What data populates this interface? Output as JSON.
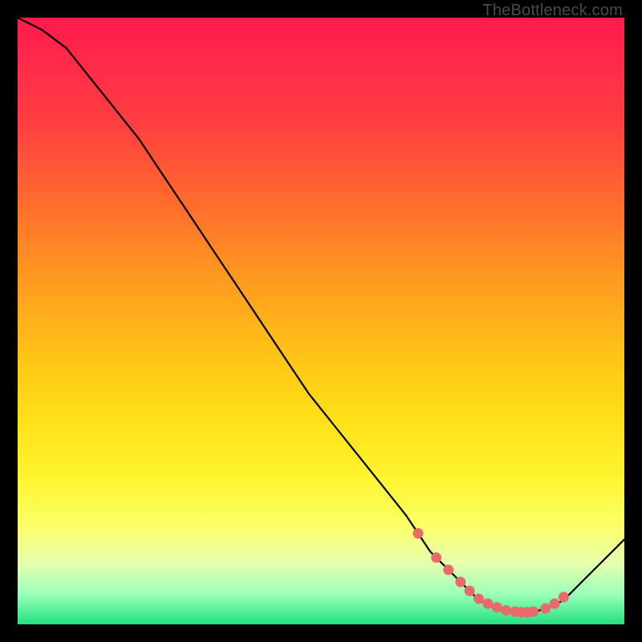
{
  "attribution": "TheBottleneck.com",
  "colors": {
    "page_bg": "#000000",
    "curve_stroke": "#000000",
    "marker_fill": "#e86a6a",
    "marker_stroke": "#e86a6a"
  },
  "chart_data": {
    "type": "line",
    "title": "",
    "xlabel": "",
    "ylabel": "",
    "xlim": [
      0,
      100
    ],
    "ylim": [
      0,
      100
    ],
    "grid": false,
    "legend": false,
    "series": [
      {
        "name": "bottleneck-curve",
        "x": [
          0,
          4,
          8,
          12,
          16,
          20,
          24,
          28,
          32,
          36,
          40,
          44,
          48,
          52,
          56,
          60,
          64,
          66,
          68,
          70,
          72,
          74,
          76,
          78,
          80,
          82,
          84,
          86,
          88,
          90,
          92,
          94,
          96,
          98,
          100
        ],
        "y": [
          100,
          98,
          95,
          90,
          85,
          80,
          74,
          68,
          62,
          56,
          50,
          44,
          38,
          33,
          28,
          23,
          18,
          15,
          12,
          10,
          8,
          6,
          4,
          3,
          2.2,
          2,
          2,
          2.3,
          3,
          4,
          6,
          8,
          10,
          12,
          14
        ]
      }
    ],
    "markers": {
      "name": "highlight-points",
      "x": [
        66,
        69,
        71,
        73,
        74.5,
        76,
        77.5,
        79,
        80.5,
        82,
        83,
        84,
        85,
        87,
        88.5,
        90
      ],
      "y": [
        15,
        11,
        9,
        7,
        5.5,
        4.2,
        3.4,
        2.8,
        2.3,
        2.1,
        2.0,
        2.0,
        2.1,
        2.6,
        3.4,
        4.5
      ]
    }
  }
}
